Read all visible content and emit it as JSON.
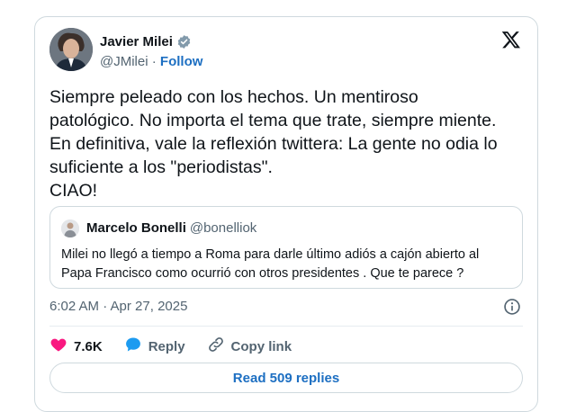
{
  "author": {
    "name": "Javier Milei",
    "handle": "@JMilei",
    "separator": " · ",
    "follow_label": "Follow",
    "verified_color": "#1d9bf0"
  },
  "tweet": {
    "lines": [
      "Siempre peleado con los hechos. Un mentiroso",
      "patológico. No importa el tema que trate, siempre miente.",
      "En definitiva, vale la reflexión twittera: La gente no odia lo",
      "suficiente a los \"periodistas\".",
      "CIAO!"
    ],
    "timestamp": "6:02 AM · Apr 27, 2025"
  },
  "quote": {
    "name": "Marcelo Bonelli",
    "handle": "@bonelliok",
    "lines": [
      "Milei no llegó a tiempo a Roma para darle último adiós a cajón abierto al",
      "Papa Francisco como ocurrió con otros presidentes . Que te parece ?"
    ]
  },
  "actions": {
    "likes": "7.6K",
    "reply_label": "Reply",
    "copy_label": "Copy link",
    "like_color": "#f91880",
    "reply_color": "#1d9bf0"
  },
  "footer": {
    "read_replies_label": "Read 509 replies"
  },
  "icons": [
    "verified-badge-icon",
    "x-logo-icon",
    "info-icon",
    "heart-icon",
    "reply-bubble-icon",
    "link-icon"
  ]
}
